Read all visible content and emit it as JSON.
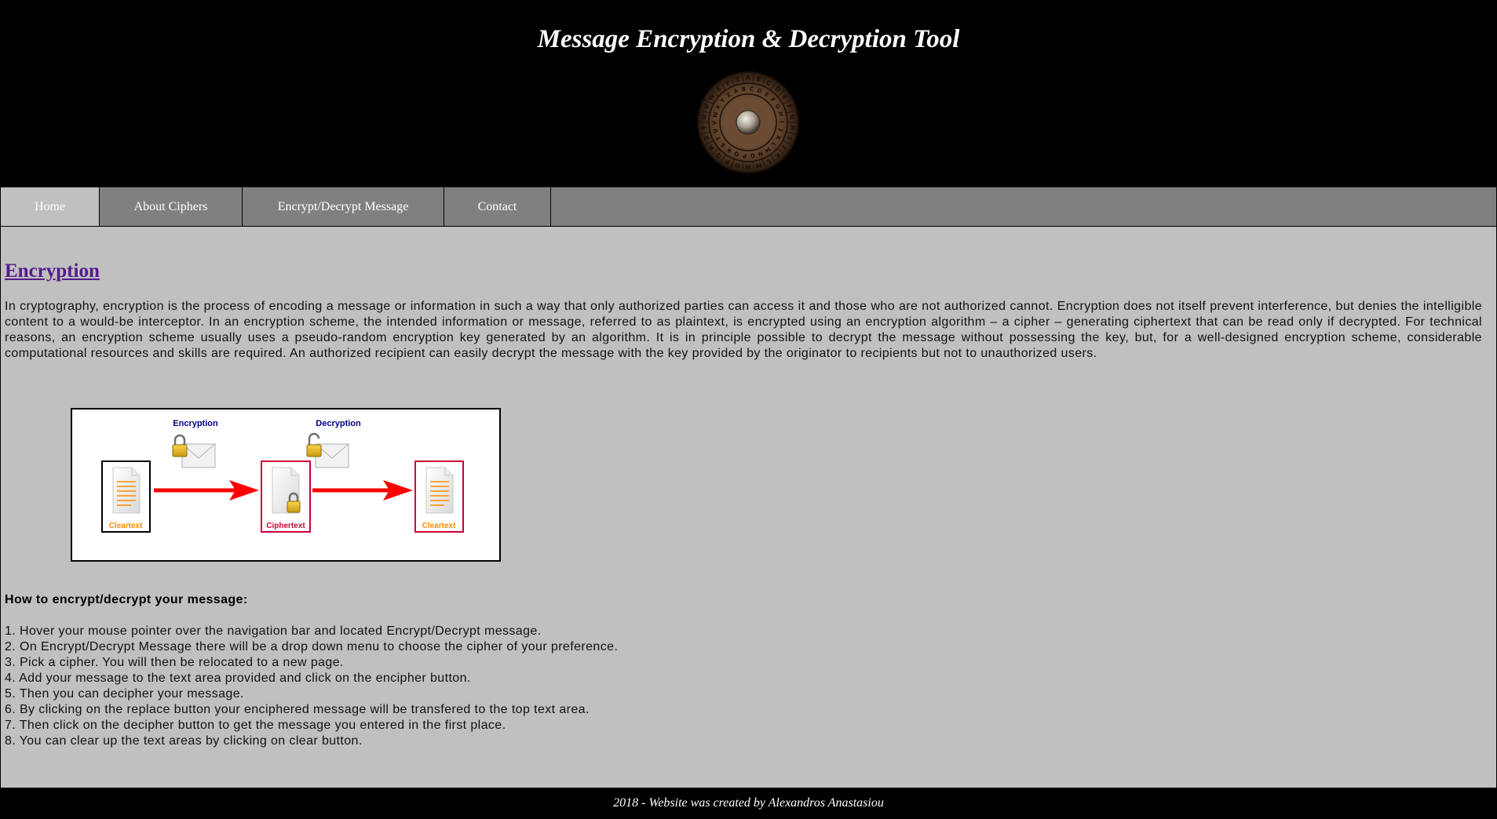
{
  "header": {
    "title": "Message Encryption & Decryption Tool",
    "logo": "cipher-wheel-logo"
  },
  "nav": {
    "items": [
      {
        "label": "Home",
        "active": true
      },
      {
        "label": "About Ciphers",
        "active": false
      },
      {
        "label": "Encrypt/Decrypt Message",
        "active": false
      },
      {
        "label": "Contact",
        "active": false
      }
    ]
  },
  "main": {
    "section_title": "Encryption",
    "intro": "In cryptography, encryption is the process of encoding a message or information in such a way that only authorized parties can access it and those who are not authorized cannot. Encryption does not itself prevent interference, but denies the intelligible content to a would-be interceptor. In an encryption scheme, the intended information or message, referred to as plaintext, is encrypted using an encryption algorithm – a cipher – generating ciphertext that can be read only if decrypted. For technical reasons, an encryption scheme usually uses a pseudo-random encryption key generated by an algorithm. It is in principle possible to decrypt the message without possessing the key, but, for a well-designed encryption scheme, considerable computational resources and skills are required. An authorized recipient can easily decrypt the message with the key provided by the originator to recipients but not to unauthorized users.",
    "diagram": {
      "encryption_label": "Encryption",
      "decryption_label": "Decryption",
      "doc1_label": "Cleartext",
      "doc2_label": "Ciphertext",
      "doc3_label": "Cleartext"
    },
    "howto_title": "How to encrypt/decrypt your message:",
    "steps": [
      "1. Hover your mouse pointer over the navigation bar and located Encrypt/Decrypt message.",
      "2. On Encrypt/Decrypt Message there will be a drop down menu to choose the cipher of your preference.",
      "3. Pick a cipher. You will then be relocated to a new page.",
      "4. Add your message to the text area provided and click on the encipher button.",
      "5. Then you can decipher your message.",
      "6. By clicking on the replace button your enciphered message will be transfered to the top text area.",
      "7. Then click on the decipher button to get the message you entered in the first place.",
      "8. You can clear up the text areas by clicking on clear button."
    ]
  },
  "footer": {
    "text": "2018 - Website was created by Alexandros Anastasiou"
  },
  "colors": {
    "header_bg": "#000000",
    "nav_bg": "#808080",
    "nav_active_bg": "#c0c0c0",
    "content_bg": "#c0c0c0",
    "link": "#551a8b",
    "arrow": "#ff0000",
    "cleartext_label": "#ff8c00",
    "ciphertext_label": "#cc0033"
  }
}
